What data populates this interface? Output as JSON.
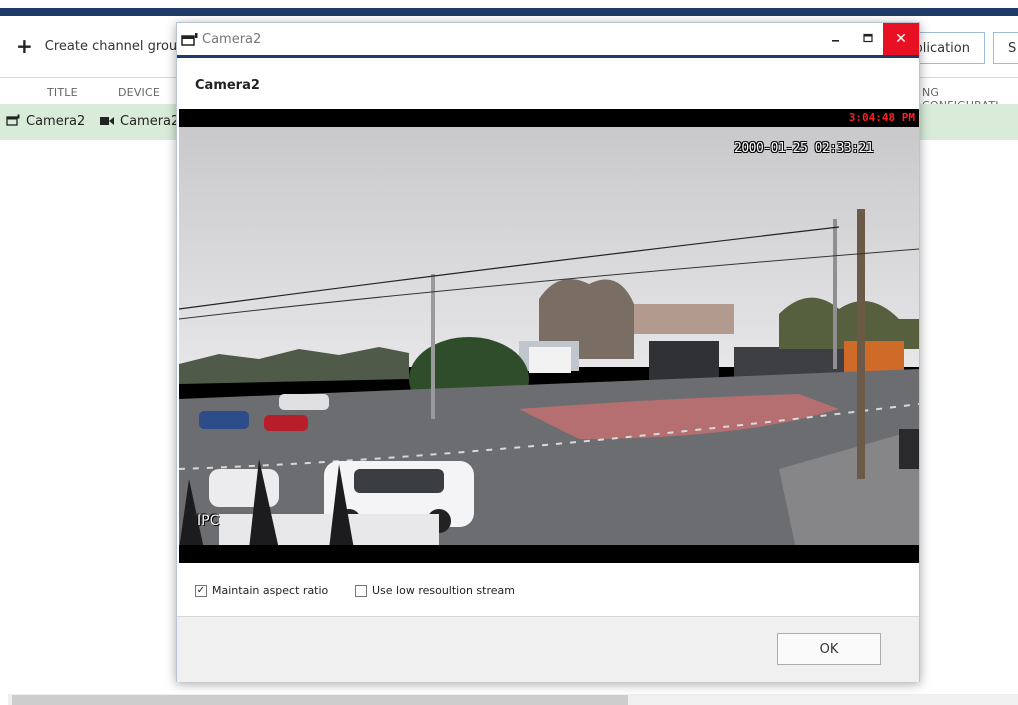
{
  "app": {
    "toolbar": {
      "create_label": "Create channel grou",
      "application_label": "plication",
      "second_label": "S"
    },
    "columns": [
      "TITLE",
      "DEVICE",
      "NG CONFIGURATI"
    ],
    "row": {
      "title": "Camera2",
      "device": "Camera2"
    },
    "colors": {
      "top_bar": "#1f3a66",
      "selected_row": "#d9ecd9"
    }
  },
  "dialog": {
    "window_title": "Camera2",
    "heading": "Camera2",
    "controls": {
      "minimize_icon": "minimize-icon",
      "maximize_icon": "maximize-icon",
      "close_icon": "close-icon",
      "close_color": "#e81123"
    },
    "video": {
      "time_overlay": "3:04:48 PM",
      "date_overlay": "2000-01-25 02:33:21",
      "ipc_label": "IPC"
    },
    "options": {
      "maintain_aspect_ratio": {
        "label": "Maintain aspect ratio",
        "checked": true
      },
      "low_resolution": {
        "label": "Use low resoultion stream",
        "checked": false
      }
    },
    "ok_label": "OK"
  }
}
